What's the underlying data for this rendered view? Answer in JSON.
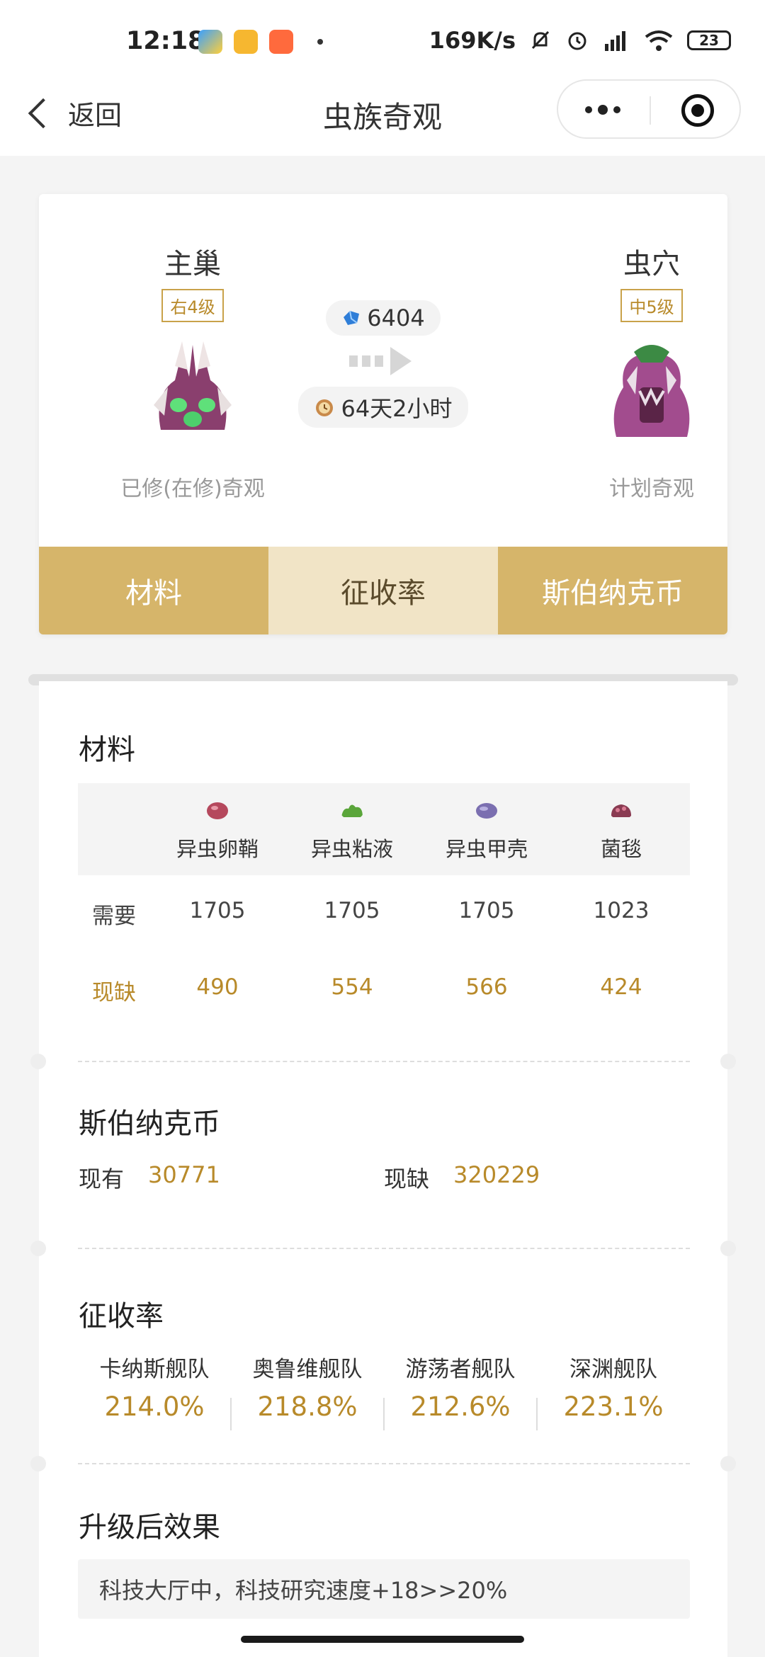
{
  "status_bar": {
    "time": "12:18",
    "net_speed": "169K/s",
    "battery": "23",
    "icons": [
      "send-icon",
      "memo-icon",
      "mi-store-icon",
      "mute-bell-icon",
      "alarm-icon",
      "signal-icon",
      "wifi-icon",
      "battery-icon"
    ]
  },
  "nav": {
    "back_label": "返回",
    "title": "虫族奇观"
  },
  "upgrade": {
    "from": {
      "name": "主巢",
      "level": "右4级",
      "caption": "已修(在修)奇观"
    },
    "to": {
      "name": "虫穴",
      "level": "中5级",
      "caption": "计划奇观"
    },
    "crystal_cost": "6404",
    "duration": "64天2小时"
  },
  "tabs": [
    {
      "label": "材料",
      "active": false
    },
    {
      "label": "征收率",
      "active": true
    },
    {
      "label": "斯伯纳克币",
      "active": false
    }
  ],
  "materials": {
    "title": "材料",
    "items": [
      {
        "name": "异虫卵鞘",
        "need": "1705",
        "lack": "490",
        "color": "#b5485d"
      },
      {
        "name": "异虫粘液",
        "need": "1705",
        "lack": "554",
        "color": "#5aa53a"
      },
      {
        "name": "异虫甲壳",
        "need": "1705",
        "lack": "566",
        "color": "#7b6fb0"
      },
      {
        "name": "菌毯",
        "need": "1023",
        "lack": "424",
        "color": "#8a3b52"
      }
    ],
    "need_label": "需要",
    "lack_label": "现缺"
  },
  "coins": {
    "title": "斯伯纳克币",
    "have_label": "现有",
    "have_value": "30771",
    "lack_label": "现缺",
    "lack_value": "320229"
  },
  "rates": {
    "title": "征收率",
    "items": [
      {
        "name": "卡纳斯舰队",
        "value": "214.0%"
      },
      {
        "name": "奥鲁维舰队",
        "value": "218.8%"
      },
      {
        "name": "游荡者舰队",
        "value": "212.6%"
      },
      {
        "name": "深渊舰队",
        "value": "223.1%"
      }
    ]
  },
  "effect": {
    "title": "升级后效果",
    "text": "科技大厅中，科技研究速度+18>>20%"
  },
  "colors": {
    "accent": "#d6b56a",
    "accent_text": "#b88a2a",
    "tab_active_bg": "#f1e4c6"
  }
}
